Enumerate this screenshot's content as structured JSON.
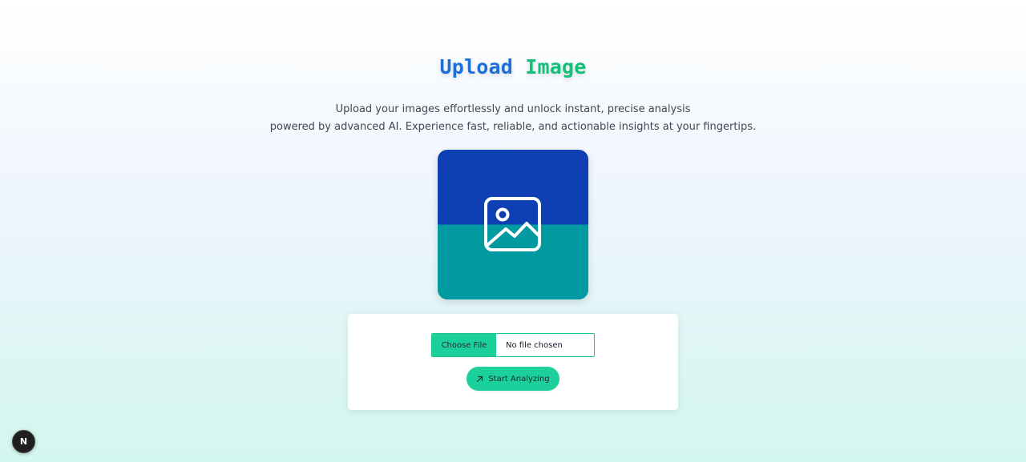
{
  "header": {
    "title_word1": "Upload",
    "title_word2": "Image",
    "subtitle_line1": "Upload your images effortlessly and unlock instant, precise analysis",
    "subtitle_line2": "powered by advanced AI. Experience fast, reliable, and actionable insights at your fingertips."
  },
  "preview": {
    "icon": "image-icon",
    "top_color": "#0e40b4",
    "bottom_color": "#009aa0"
  },
  "upload_form": {
    "choose_file_label": "Choose File",
    "file_status": "No file chosen",
    "analyze_label": "Start Analyzing",
    "analyze_icon": "arrow-up-right-icon",
    "accent_color": "#1bd09a"
  },
  "dev_badge": {
    "label": "N"
  },
  "colors": {
    "title_blue": "#1d6fd6",
    "title_green": "#13c07a"
  }
}
